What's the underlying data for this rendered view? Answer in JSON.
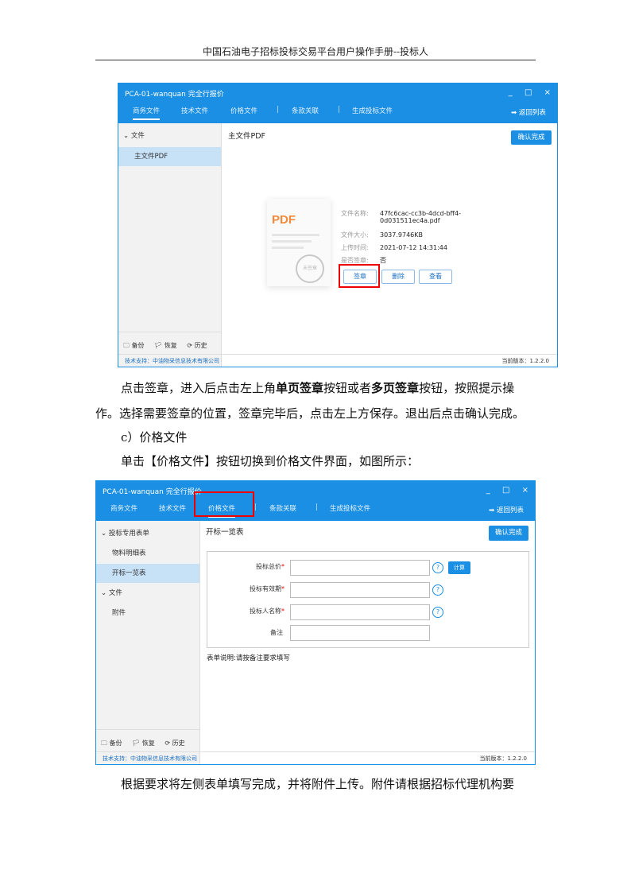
{
  "page": {
    "header": "中国石油电子招标投标交易平台用户操作手册--投标人"
  },
  "window1": {
    "title": "PCA-01-wanquan 完全行报价",
    "controls": [
      "_",
      "□",
      "×"
    ],
    "tabs": [
      "商务文件",
      "技术文件",
      "价格文件",
      "|",
      "条款关联",
      "|",
      "生成投标文件"
    ],
    "return_label": "➡ 返回列表",
    "sidebar": {
      "group": "⌄ 文件",
      "item": "主文件PDF"
    },
    "footer_actions": [
      "🗀 备份",
      "🏳 恢复",
      "⟳ 历史"
    ],
    "support": "技术支持：中油物采信息技术有限公司",
    "version": "当前版本：1.2.2.0",
    "content_title": "主文件PDF",
    "confirm": "确认完成",
    "pdf_icon_text": "PDF",
    "seal_text": "未签章",
    "file_info": [
      {
        "key": "文件名称:",
        "value": "47fc6cac-cc3b-4dcd-bff4-"
      },
      {
        "key": "",
        "value": "0d031511ec4a.pdf"
      },
      {
        "key": "文件大小:",
        "value": "3037.9746KB"
      },
      {
        "key": "上传时间:",
        "value": "2021-07-12 14:31:44"
      },
      {
        "key": "是否签章:",
        "value": "否"
      }
    ],
    "buttons": {
      "sign": "签章",
      "delete": "删除",
      "view": "查看"
    }
  },
  "paragraphs": {
    "p1_a": "点击签章，进入后点击左上角",
    "p1_b": "单页签章",
    "p1_c": "按钮或者",
    "p1_d": "多页签章",
    "p1_e": "按钮，按照提示操",
    "p2": "作。选择需要签章的位置，签章完毕后，点击左上方保存。退出后点击确认完成。",
    "p3": "c）价格文件",
    "p4": "单击【价格文件】按钮切换到价格文件界面，如图所示：",
    "p5": "根据要求将左侧表单填写完成，并将附件上传。附件请根据招标代理机构要"
  },
  "window2": {
    "title": "PCA-01-wanquan 完全行报价",
    "controls": [
      "_",
      "□",
      "×"
    ],
    "tabs": [
      "商务文件",
      "技术文件",
      "价格文件",
      "|",
      "条款关联",
      "|",
      "生成投标文件"
    ],
    "return_label": "➡ 返回列表",
    "sidebar": {
      "group1": "⌄ 投标专用表单",
      "item1": "物料明细表",
      "item2": "开标一览表",
      "group2": "⌄ 文件",
      "item3": "附件"
    },
    "footer_actions": [
      "🗀 备份",
      "🏳 恢复",
      "⟳ 历史"
    ],
    "support": "技术支持：中油物采信息技术有限公司",
    "version": "当前版本：1.2.2.0",
    "content_title": "开标一览表",
    "confirm": "确认完成",
    "form": {
      "fields": [
        {
          "label": "投标总价",
          "required": true
        },
        {
          "label": "投标有效期",
          "required": true
        },
        {
          "label": "投标人名称",
          "required": true
        },
        {
          "label": "备注",
          "required": false
        }
      ],
      "calc": "计算",
      "help": "?"
    },
    "form_note": "表单说明:请按备注要求填写"
  }
}
